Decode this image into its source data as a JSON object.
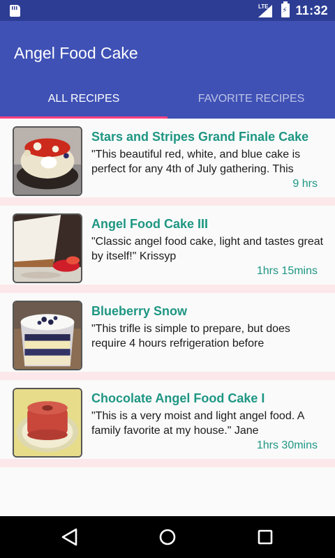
{
  "status_bar": {
    "network_label": "LTE",
    "time": "11:32",
    "icons": [
      "sd-card-icon",
      "signal-icon",
      "battery-charging-icon"
    ]
  },
  "app": {
    "title": "Angel Food Cake",
    "colors": {
      "primary": "#3f51b5",
      "primary_dark": "#2c3d93",
      "accent": "#ff4081",
      "title_text": "#1e9683",
      "separator": "#fce8ea"
    }
  },
  "tabs": [
    {
      "label": "ALL RECIPES",
      "selected": true
    },
    {
      "label": "FAVORITE RECIPES",
      "selected": false
    }
  ],
  "recipes": [
    {
      "title": "Stars and Stripes Grand Finale Cake",
      "description": "\"This beautiful red, white, and blue cake is perfect for any 4th of July gathering. This",
      "time": "9 hrs",
      "image": "stars-stripes-cake-photo"
    },
    {
      "title": "Angel Food Cake III",
      "description": "\"Classic angel food cake, light and tastes great by itself!\"  Krissyp",
      "time": "1hrs 15mins",
      "image": "angel-food-cake-slice-photo"
    },
    {
      "title": "Blueberry Snow",
      "description": "\"This trifle is simple to prepare, but does require 4 hours refrigeration before",
      "time": "",
      "image": "blueberry-trifle-photo"
    },
    {
      "title": "Chocolate Angel Food Cake I",
      "description": "\"This is a very moist and light angel food. A family favorite at my house.\"  Jane",
      "time": "1hrs 30mins",
      "image": "chocolate-angel-cake-photo"
    }
  ],
  "nav_bar": {
    "buttons": [
      "back-icon",
      "home-icon",
      "recents-icon"
    ]
  }
}
